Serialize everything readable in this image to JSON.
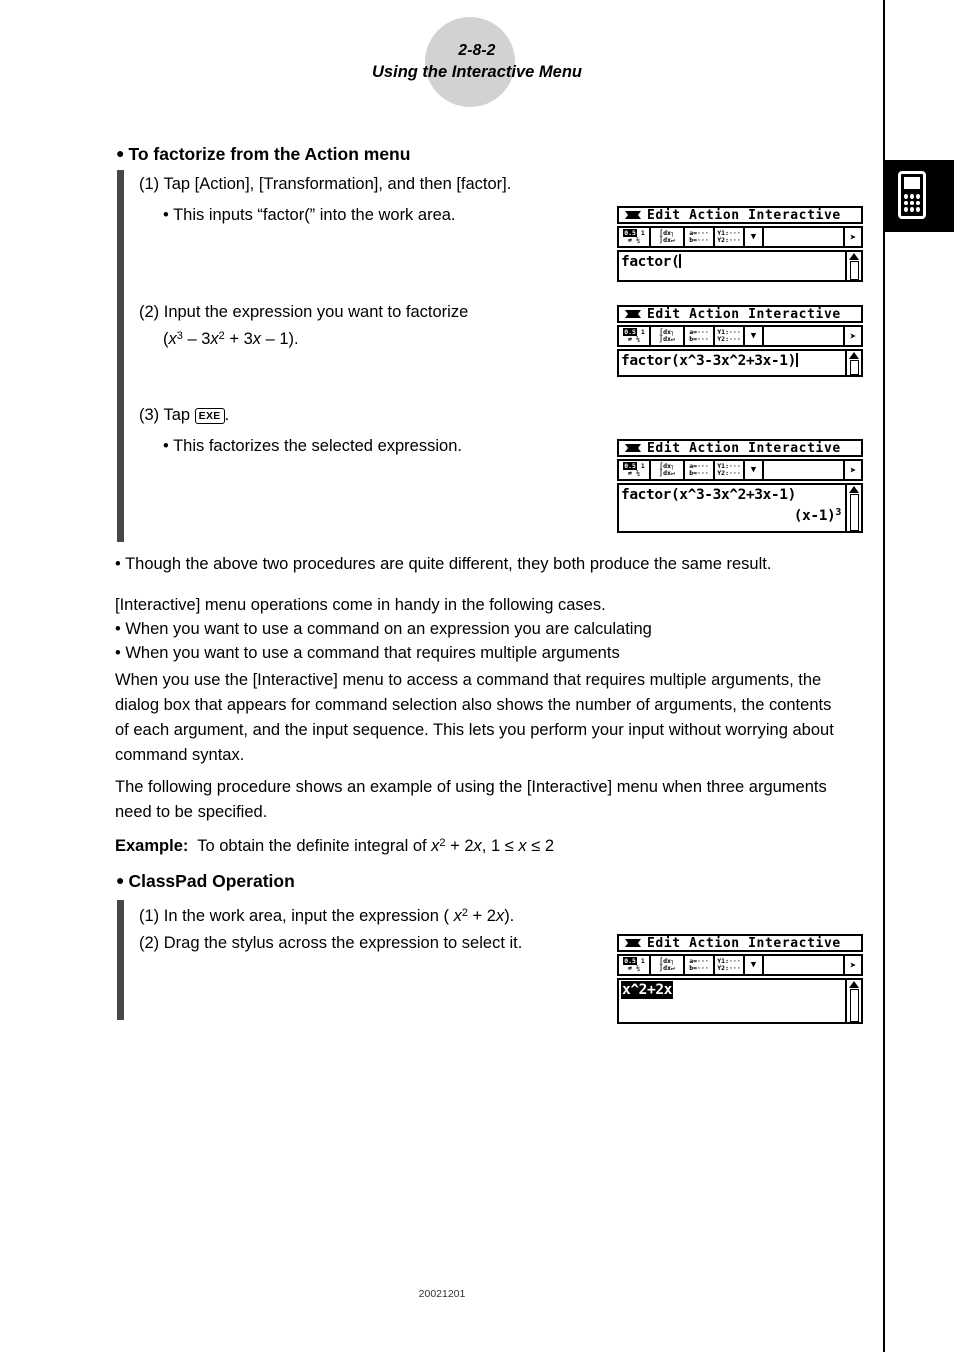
{
  "page": {
    "header_number": "2-8-2",
    "header_title": "Using the Interactive Menu",
    "footer_code": "20021201",
    "side_tab_icon": "calculator-icon"
  },
  "sections": [
    {
      "heading": "To factorize from the Action menu",
      "steps": [
        {
          "label": "(1) Tap [Action], [Transformation], and then [factor]."
        },
        {
          "label": "• This inputs “factor(” into the work area."
        },
        {
          "label": "(2) Input the expression you want to factorize"
        },
        {
          "label": "(x³ – 3x² + 3x – 1)."
        },
        {
          "label": "(3) Tap EXE ."
        },
        {
          "label": "• This factorizes the selected expression."
        }
      ]
    },
    {
      "heading": "ClassPad Operation",
      "steps": [
        {
          "label": "(1) In the work area, input the expression ( x² + 2x)."
        },
        {
          "label": "(2) Drag the stylus across the expression to select it."
        }
      ]
    }
  ],
  "body": {
    "note_bullet": "• Though the above two procedures are quite different, they both produce the same result.",
    "intro_line": "[Interactive] menu operations come in handy in the following cases.",
    "case_bullet_1": "• When you want to use a command on an expression you are calculating",
    "case_bullet_2": "• When you want to use a command that requires multiple arguments",
    "paragraph_1": "When you use the [Interactive] menu to access a command that requires multiple arguments, the dialog box that appears for command selection also shows the number of arguments, the contents of each argument, and the input sequence. This lets you perform your input without worrying about command syntax.",
    "paragraph_2": "The following procedure shows an example of using the [Interactive] menu when three arguments need to be specified.",
    "example_label": "Example:",
    "example_text_pre": "To obtain the definite integral of ",
    "example_expr": "x² + 2x, 1 ≤ x ≤ 2"
  },
  "step_text": {
    "s1_main": "(1) Tap [Action], [Transformation], and then [factor].",
    "s1_sub": "• This inputs “factor(” into the work area.",
    "s2_main": "(2) Input the expression you want to factorize",
    "s3_pre": "(3) Tap ",
    "s3_key": "EXE",
    "s3_post": ".",
    "s3_sub": "• This factorizes the selected expression.",
    "cp1_pre": "(1) In the work area, input the expression ( ",
    "cp1_post": ").",
    "cp2": "(2) Drag the stylus across the expression to select it."
  },
  "calc_screens": [
    {
      "id": "screen-1",
      "menubar": "Edit Action Interactive",
      "toolbar": [
        "0.5 1",
        "∫dx",
        "a=",
        "Y1:",
        "dropdown",
        "",
        "next"
      ],
      "work_lines": [
        "factor("
      ],
      "cursor": true
    },
    {
      "id": "screen-2",
      "menubar": "Edit Action Interactive",
      "work_lines": [
        "factor(x^3-3x^2+3x-1)"
      ],
      "cursor": true
    },
    {
      "id": "screen-3",
      "menubar": "Edit Action Interactive",
      "work_lines": [
        "factor(x^3-3x^2+3x-1)"
      ],
      "result": "(x-1)",
      "result_exp": "3"
    },
    {
      "id": "screen-4",
      "menubar": "Edit Action Interactive",
      "selected_expression": "x^2+2x"
    }
  ],
  "toolbar_glyphs": {
    "b1_top": "0.5  1",
    "b1_bot": "⇄  ½",
    "b2_top": "∫dx┐",
    "b2_bot": "∫dx↵",
    "b3_top": "a=···",
    "b3_bot": "b=···",
    "b4_top": "Y1:···",
    "b4_bot": "Y2:···",
    "drop": "▼",
    "next": "➤"
  }
}
